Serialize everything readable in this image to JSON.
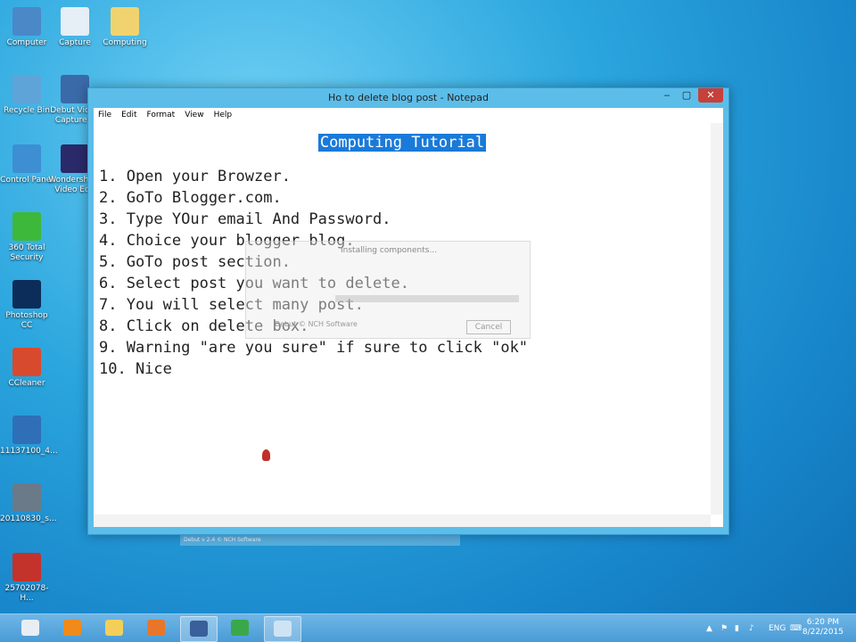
{
  "desktop": {
    "icons": [
      {
        "name": "Computer",
        "color": "#4a88c8"
      },
      {
        "name": "Capture",
        "color": "#e6eef6"
      },
      {
        "name": "Computing",
        "color": "#f0d36e"
      },
      {
        "name": "Recycle Bin",
        "color": "#5fa4d8"
      },
      {
        "name": "Debut Video Capture S",
        "color": "#3a6aa8"
      },
      {
        "name": "Control Panel",
        "color": "#3d8ed3"
      },
      {
        "name": "Wondershare Video Edit",
        "color": "#2a2a6a"
      },
      {
        "name": "360 Total Security",
        "color": "#3db83a"
      },
      {
        "name": "Photoshop CC",
        "color": "#0c2d5a"
      },
      {
        "name": "CCleaner",
        "color": "#d84a2e"
      },
      {
        "name": "11137100_4...",
        "color": "#2e6fb8"
      },
      {
        "name": "20110830_s...",
        "color": "#6a7a88"
      },
      {
        "name": "25702078-H...",
        "color": "#c4322c"
      }
    ]
  },
  "window": {
    "title": "Ho to delete blog post - Notepad",
    "minimize": "‒",
    "maximize": "▢",
    "close": "✕",
    "menu": [
      "File",
      "Edit",
      "Format",
      "View",
      "Help"
    ],
    "heading": "Computing Tutorial",
    "lines": [
      "1. Open your Browzer.",
      "2. GoTo Blogger.com.",
      "3. Type YOur email And Password.",
      "4. Choice your blogger blog.",
      "5. GoTo post section.",
      "6. Select post you want to delete.",
      "7. You will select many post.",
      "8. Click on delete box.",
      "9. Warning \"are you sure\" if sure to click \"ok\"",
      "10. Nice"
    ]
  },
  "ghost_dialog": {
    "title": "Installing components...",
    "copyright": "Debut © NCH Software",
    "cancel": "Cancel"
  },
  "ghost_taskbutton": "Debut v 2.4 © NCH Software",
  "taskbar": {
    "items": [
      {
        "name": "360-security",
        "color": "#e9eef4",
        "active": false
      },
      {
        "name": "vlc",
        "color": "#f08a1a",
        "active": false
      },
      {
        "name": "file-explorer",
        "color": "#f1cf5a",
        "active": false
      },
      {
        "name": "firefox",
        "color": "#e8762a",
        "active": false
      },
      {
        "name": "debut",
        "color": "#3a5f9a",
        "active": true
      },
      {
        "name": "chrome",
        "color": "#3aa84a",
        "active": false
      },
      {
        "name": "notepad",
        "color": "#cfe4f2",
        "active": true
      }
    ],
    "language": "ENG",
    "time": "6:20 PM",
    "date": "8/22/2015"
  }
}
